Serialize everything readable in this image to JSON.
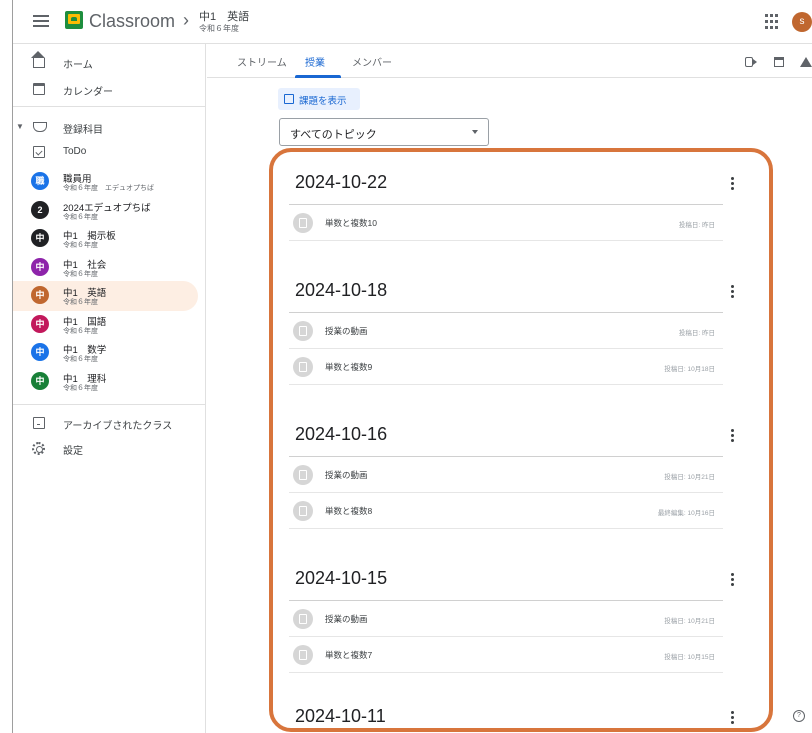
{
  "header": {
    "app_name": "Classroom",
    "breadcrumb_class": "中1　英語",
    "breadcrumb_sub": "令和６年度",
    "avatar_letter": "s"
  },
  "sidebar": {
    "home": "ホーム",
    "calendar": "カレンダー",
    "enrolled": "登録科目",
    "todo": "ToDo",
    "classes": [
      {
        "initial": "職",
        "name": "職員用",
        "sub": "令和６年度　エデュオプちば",
        "color": "#1a73e8",
        "active": false
      },
      {
        "initial": "2",
        "name": "2024エデュオプちば",
        "sub": "令和６年度",
        "color": "#202124",
        "active": false
      },
      {
        "initial": "中",
        "name": "中1　掲示板",
        "sub": "令和６年度",
        "color": "#202124",
        "active": false
      },
      {
        "initial": "中",
        "name": "中1　社会",
        "sub": "令和６年度",
        "color": "#8e24aa",
        "active": false
      },
      {
        "initial": "中",
        "name": "中1　英語",
        "sub": "令和６年度",
        "color": "#c0672f",
        "active": true
      },
      {
        "initial": "中",
        "name": "中1　国語",
        "sub": "令和６年度",
        "color": "#c2185b",
        "active": false
      },
      {
        "initial": "中",
        "name": "中1　数学",
        "sub": "令和６年度",
        "color": "#1a73e8",
        "active": false
      },
      {
        "initial": "中",
        "name": "中1　理科",
        "sub": "令和６年度",
        "color": "#188038",
        "active": false
      }
    ],
    "archived": "アーカイブされたクラス",
    "settings": "設定"
  },
  "tabs": {
    "stream": "ストリーム",
    "classwork": "授業",
    "members": "メンバー"
  },
  "toolbar": {
    "view_assignments": "課題を表示",
    "topic_select": "すべてのトピック"
  },
  "sections": [
    {
      "title": "2024-10-22",
      "items": [
        {
          "title": "単数と複数10",
          "date": "投稿日: 昨日"
        }
      ]
    },
    {
      "title": "2024-10-18",
      "items": [
        {
          "title": "授業の動画",
          "date": "投稿日: 昨日"
        },
        {
          "title": "単数と複数9",
          "date": "投稿日: 10月18日"
        }
      ]
    },
    {
      "title": "2024-10-16",
      "items": [
        {
          "title": "授業の動画",
          "date": "投稿日: 10月21日"
        },
        {
          "title": "単数と複数8",
          "date": "最終編集: 10月16日"
        }
      ]
    },
    {
      "title": "2024-10-15",
      "items": [
        {
          "title": "授業の動画",
          "date": "投稿日: 10月21日"
        },
        {
          "title": "単数と複数7",
          "date": "投稿日: 10月15日"
        }
      ]
    },
    {
      "title": "2024-10-11",
      "items": []
    }
  ],
  "colors": {
    "accent": "#1967d2",
    "highlight": "#d8753c",
    "active_bg": "#fdeee3"
  },
  "icons": [
    "menu-icon",
    "classroom-logo-icon",
    "apps-grid-icon",
    "home-icon",
    "calendar-icon",
    "graduation-cap-icon",
    "todo-icon",
    "archive-icon",
    "gear-icon",
    "meet-icon",
    "drive-icon",
    "assignment-icon",
    "more-vert-icon",
    "help-icon"
  ]
}
